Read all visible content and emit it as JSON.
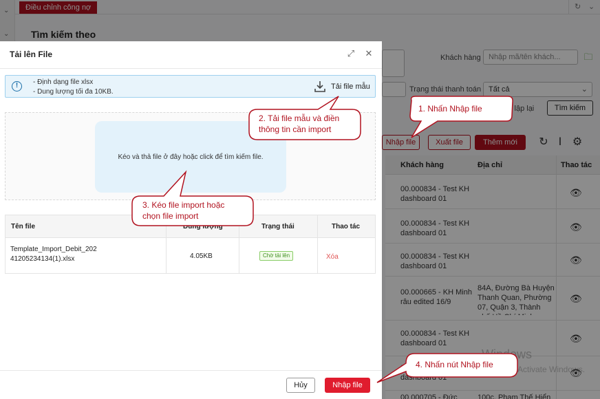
{
  "background": {
    "tab_label": "Điều chỉnh công nợ",
    "search_title": "Tìm kiếm theo",
    "customer_label": "Khách hàng",
    "customer_placeholder": "Nhập mã/tên khách...",
    "payment_status_label": "Trạng thái thanh toán",
    "payment_status_value": "Tất cả",
    "reset_label": "Thiết lập lại",
    "search_button": "Tìm kiếm",
    "import_button": "Nhập file",
    "export_button": "Xuất file",
    "add_button": "Thêm mới",
    "table": {
      "headers": {
        "customer": "Khách hàng",
        "address": "Địa chỉ",
        "actions": "Thao tác"
      },
      "rows": [
        {
          "customer": "00.000834 - Test KH dashboard 01",
          "address": ""
        },
        {
          "customer": "00.000834 - Test KH dashboard 01",
          "address": ""
        },
        {
          "customer": "00.000834 - Test KH dashboard 01",
          "address": ""
        },
        {
          "customer": "00.000665 - KH Minh râu edited 16/9",
          "address": "84A, Đường Bà Huyện Thanh Quan, Phường 07, Quận 3, Thành phố Hồ Chí Minh"
        },
        {
          "customer": "00.000834 - Test KH dashboard 01",
          "address": ""
        },
        {
          "customer": "00.000834 - Test KH dashboard 01",
          "address": ""
        },
        {
          "customer": "00.000705 - Đức",
          "address": "100c, Phạm Thế Hiển"
        }
      ]
    },
    "watermark_line1": "Windows",
    "watermark_line2": "Activate Windows."
  },
  "modal": {
    "title": "Tải lên File",
    "info_lines": [
      "- Định dạng file xlsx",
      "- Dung lượng tối đa 10KB."
    ],
    "download_template": "Tải file mẫu",
    "dropzone_text": "Kéo và thả file ở đây hoặc click để tìm kiếm file.",
    "file_table": {
      "headers": {
        "name": "Tên file",
        "size": "Dung lượng",
        "status": "Trạng thái",
        "actions": "Thao tác"
      },
      "rows": [
        {
          "name_line1": "Template_Import_Debit_202",
          "name_line2": "41205234134(1).xlsx",
          "size": "4.05KB",
          "status": "Chờ tải lên",
          "action": "Xóa"
        }
      ]
    },
    "cancel_button": "Hủy",
    "import_button": "Nhập file"
  },
  "callouts": [
    {
      "lines": [
        "1. Nhấn Nhập file"
      ]
    },
    {
      "lines": [
        "2. Tải file mẫu và điền",
        "thông tin cần import"
      ]
    },
    {
      "lines": [
        "3. Kéo file import hoặc",
        "chọn file import"
      ]
    },
    {
      "lines": [
        "4. Nhấn nút Nhập file"
      ]
    }
  ],
  "colors": {
    "brand_red": "#b1121f",
    "primary_button": "#e01c2e",
    "info_bg": "#e8f4fb",
    "callout_border": "#b1121f"
  }
}
